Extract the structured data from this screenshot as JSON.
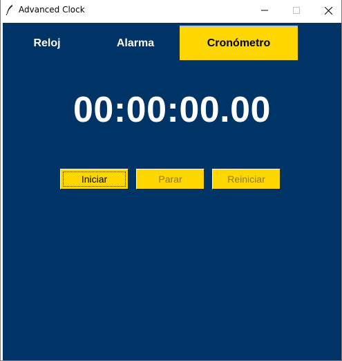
{
  "window": {
    "title": "Advanced Clock"
  },
  "tabs": [
    {
      "label": "Reloj",
      "active": false
    },
    {
      "label": "Alarma",
      "active": false
    },
    {
      "label": "Cronómetro",
      "active": true
    }
  ],
  "stopwatch": {
    "time": "00:00:00.00"
  },
  "controls": {
    "start_label": "Iniciar",
    "stop_label": "Parar",
    "reset_label": "Reiniciar",
    "stop_enabled": false,
    "reset_enabled": false
  },
  "colors": {
    "background": "#003366",
    "accent": "#ffd700",
    "text": "#ffffff"
  },
  "icons": {
    "app": "feather-icon",
    "minimize": "minimize-icon",
    "maximize": "maximize-icon",
    "close": "close-icon"
  }
}
